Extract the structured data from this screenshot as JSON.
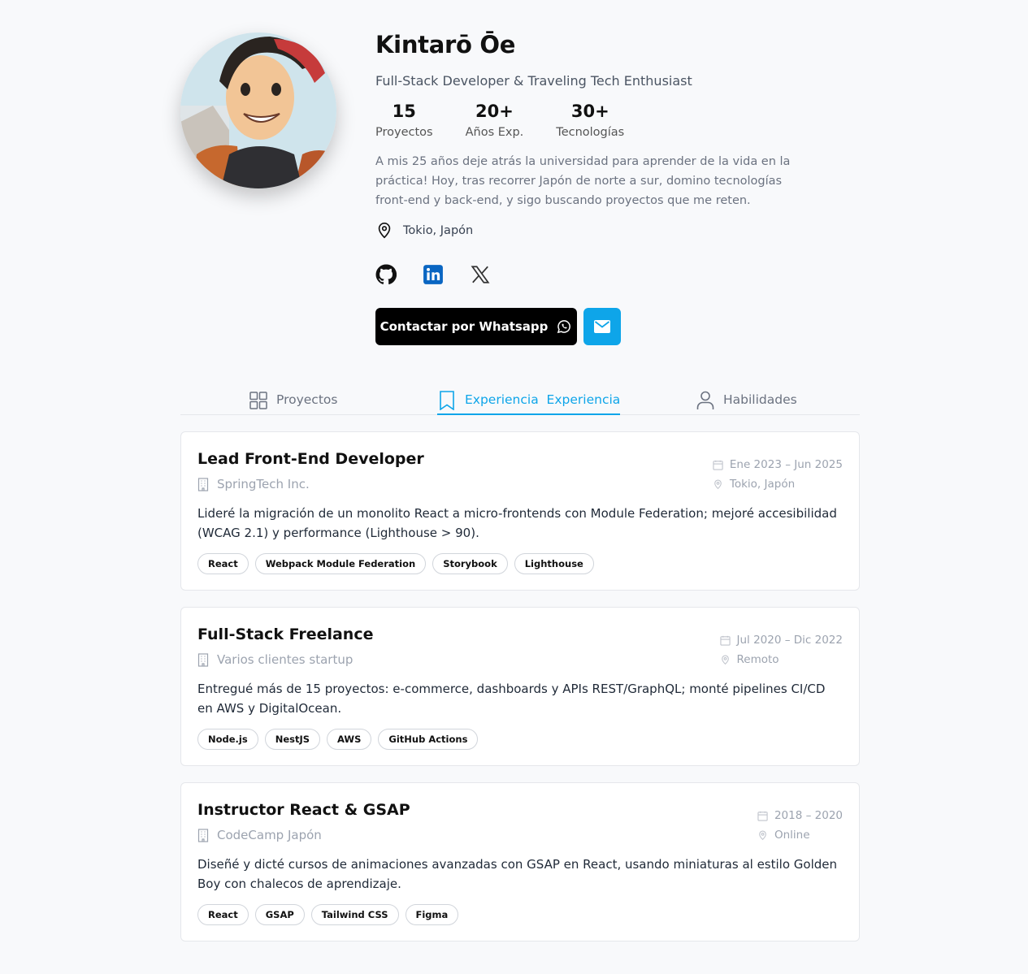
{
  "profile": {
    "name": "Kintarō Ōe",
    "tagline": "Full-Stack Developer & Traveling Tech Enthusiast",
    "stats": [
      {
        "value": "15",
        "label": "Proyectos"
      },
      {
        "value": "20+",
        "label": "Años Exp."
      },
      {
        "value": "30+",
        "label": "Tecnologías"
      }
    ],
    "bio": "A mis 25 años deje atrás la universidad para aprender de la vida en la práctica! Hoy, tras recorrer Japón de norte a sur, domino tecnologías front-end y back-end, y sigo buscando proyectos que me reten.",
    "location": "Tokio, Japón",
    "socials": [
      "github-icon",
      "linkedin-icon",
      "x-icon"
    ],
    "whatsapp_label": "Contactar por Whatsapp",
    "accent": "#0ea5e9"
  },
  "tabs": [
    {
      "label": "Proyectos",
      "icon": "grid-icon",
      "active": false
    },
    {
      "label": "Experiencia  Experiencia",
      "icon": "bookmark-icon",
      "active": true
    },
    {
      "label": "Habilidades",
      "icon": "user-icon",
      "active": false
    }
  ],
  "experience": [
    {
      "title": "Lead Front-End Developer",
      "company": "SpringTech Inc.",
      "dates": "Ene 2023 – Jun 2025",
      "location": "Tokio, Japón",
      "description": "Lideré la migración de un monolito React a micro-frontends con Module Federation; mejoré accesibilidad (WCAG 2.1) y performance (Lighthouse > 90).",
      "tags": [
        "React",
        "Webpack Module Federation",
        "Storybook",
        "Lighthouse"
      ]
    },
    {
      "title": "Full-Stack Freelance",
      "company": "Varios clientes startup",
      "dates": "Jul 2020 – Dic 2022",
      "location": "Remoto",
      "description": "Entregué más de 15 proyectos: e-commerce, dashboards y APIs REST/GraphQL; monté pipelines CI/CD en AWS y DigitalOcean.",
      "tags": [
        "Node.js",
        "NestJS",
        "AWS",
        "GitHub Actions"
      ]
    },
    {
      "title": "Instructor React & GSAP",
      "company": "CodeCamp Japón",
      "dates": "2018 – 2020",
      "location": "Online",
      "description": "Diseñé y dicté cursos de animaciones avanzadas con GSAP en React, usando miniaturas al estilo Golden Boy con chalecos de aprendizaje.",
      "tags": [
        "React",
        "GSAP",
        "Tailwind CSS",
        "Figma"
      ]
    }
  ]
}
